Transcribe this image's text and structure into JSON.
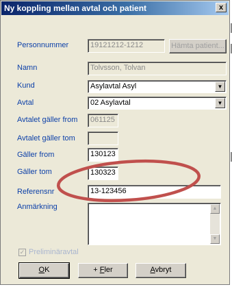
{
  "window": {
    "title": "Ny koppling mellan avtal och patient",
    "close_label": "x"
  },
  "fields": {
    "personnummer": {
      "label": "Personnummer",
      "value": "19121212-1212"
    },
    "namn": {
      "label": "Namn",
      "value": "Tolvsson, Tolvan"
    },
    "kund": {
      "label": "Kund",
      "value": "Asylavtal  Asyl"
    },
    "avtal": {
      "label": "Avtal",
      "value": "02 Asylavtal"
    },
    "avtalet_from": {
      "label": "Avtalet gäller from",
      "value": "061125"
    },
    "avtalet_tom": {
      "label": "Avtalet gäller tom",
      "value": ""
    },
    "galler_from": {
      "label": "Gäller from",
      "value": "130123"
    },
    "galler_tom": {
      "label": "Gäller tom",
      "value": "130323"
    },
    "referensnr": {
      "label": "Referensnr",
      "value": "13-123456"
    },
    "anmarkning": {
      "label": "Anmärkning",
      "value": ""
    }
  },
  "buttons": {
    "hamta_patient": "Hämta patient...",
    "ok_pre": "",
    "ok_key": "O",
    "ok_post": "K",
    "fler_pre": "+ ",
    "fler_key": "F",
    "fler_post": "ler",
    "avbryt_pre": "",
    "avbryt_key": "A",
    "avbryt_post": "vbryt"
  },
  "checkbox": {
    "label": "Preliminäravtal",
    "checked": true
  },
  "annotation": {
    "shape": "ellipse",
    "color": "#c0504d"
  },
  "colors": {
    "label": "#0b3fa8",
    "title_bg": "#0a246a",
    "face": "#ece9d8"
  }
}
